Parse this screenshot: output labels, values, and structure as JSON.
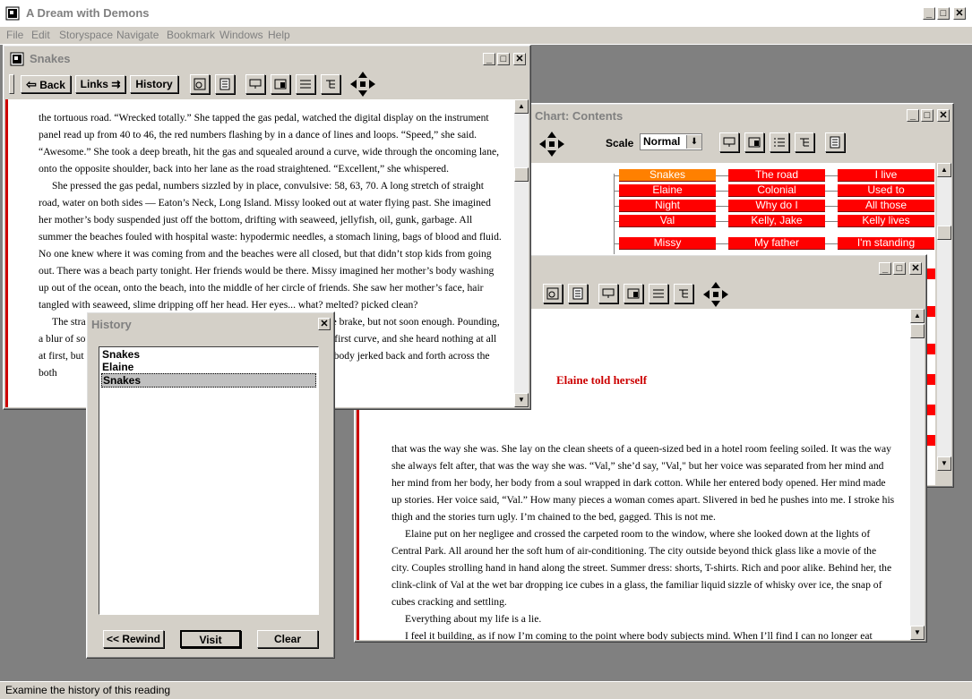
{
  "app": {
    "title": "A Dream with Demons",
    "menu": [
      "File",
      "Edit",
      "Storyspace",
      "Navigate",
      "Bookmark",
      "Windows",
      "Help"
    ],
    "status": "Examine the history of this reading"
  },
  "snakes_window": {
    "title": "Snakes",
    "toolbar": {
      "back": "Back",
      "links": "Links",
      "history": "History"
    },
    "paragraphs": [
      "the tortuous road.  “Wrecked totally.” She tapped the gas pedal, watched the digital display on the instrument panel read up from 40 to 46, the red numbers flashing by in a dance of lines and loops.  “Speed,” she said.  “Awesome.”  She took a deep breath, hit the gas and squealed around a curve, wide through the oncoming lane, onto the opposite shoulder, back into her lane as the road straightened.  “Excellent,” she whispered.",
      "She pressed the gas pedal, numbers sizzled by in place, convulsive: 58, 63, 70.  A long stretch of straight road, water on both sides — Eaton’s Neck, Long Island.  Missy looked out at water flying past.  She imagined her mother’s body suspended just off the bottom, drifting with seaweed, jellyfish, oil, gunk, garbage.  All summer the beaches fouled with hospital waste: hypodermic needles, a stomach lining, bags of blood and fluid.  No one knew where it was coming from and the beaches were all closed, but that didn’t stop kids from going out.  There was a beach party tonight.  Her friends would be there.  Missy imagined her mother’s body washing up out of the ocean, onto the beach, into the middle of her circle of friends.  She saw her mother’s face, hair tangled with seaweed, slime dripping off her head.  Her eyes... what? melted? picked clean?",
      "The straightaway was ending and she slammed her foot down on the brake, but not soon enough.  Pounding, a blur of sound and motion, spinning.  The car was off the road into the first curve, and she heard nothing at all at first, but then she heard glass breaking, and the right headlight... her body jerked back and forth across the both"
    ]
  },
  "history_window": {
    "title": "History",
    "items": [
      "Snakes",
      "Elaine",
      "Snakes"
    ],
    "selected_index": 2,
    "buttons": {
      "rewind": "<< Rewind",
      "visit": "Visit",
      "clear": "Clear"
    }
  },
  "chart_window": {
    "title": "Chart: Contents",
    "scale_label": "Scale",
    "scale_value": "Normal",
    "columns": [
      [
        "Snakes",
        "Elaine",
        "Night",
        "Val",
        "Missy"
      ],
      [
        "The road",
        "Colonial",
        "Why do I",
        "Kelly, Jake",
        "My father"
      ],
      [
        "I live",
        "Used to",
        "All  those",
        "Kelly lives",
        "I'm standing"
      ]
    ],
    "selected_node": "Snakes",
    "colors": {
      "node": "#ff0000",
      "selected": "#ff8000"
    }
  },
  "elaine_window": {
    "heading": "Elaine told herself",
    "paragraphs": [
      "that was the way she was.  She lay on the clean sheets of a queen-sized bed in a hotel room feeling soiled.  It was the way she always felt after, that was the way she was.  “Val,” she’d say, \"Val,\" but her voice was separated from her mind and her mind from her body, her body from a soul wrapped in dark cotton.  While her entered body opened.  Her mind made up stories.  Her voice said, “Val.”  How many pieces a woman comes apart.  Slivered in bed he pushes into me.  I stroke his thigh and the stories turn ugly.  I’m chained to the bed, gagged.  This is not me.",
      "Elaine put on her negligee and crossed the carpeted room to the window, where she looked down at the lights of Central Park.  All around her the soft hum of air-conditioning.  The city outside beyond thick glass like a movie of the city.  Couples strolling hand in hand along the street.  Summer dress: shorts, T-shirts.  Rich and poor alike.  Behind her, the clink-clink of Val at the wet bar dropping ice cubes in a glass, the familiar liquid sizzle of whisky over ice, the snap of cubes cracking and settling.",
      "Everything about my life is a lie.",
      "I feel it building, as if now I’m coming to the point where body subjects mind.  When I’ll find I can no longer eat"
    ],
    "heading_color": "#cc0000"
  }
}
